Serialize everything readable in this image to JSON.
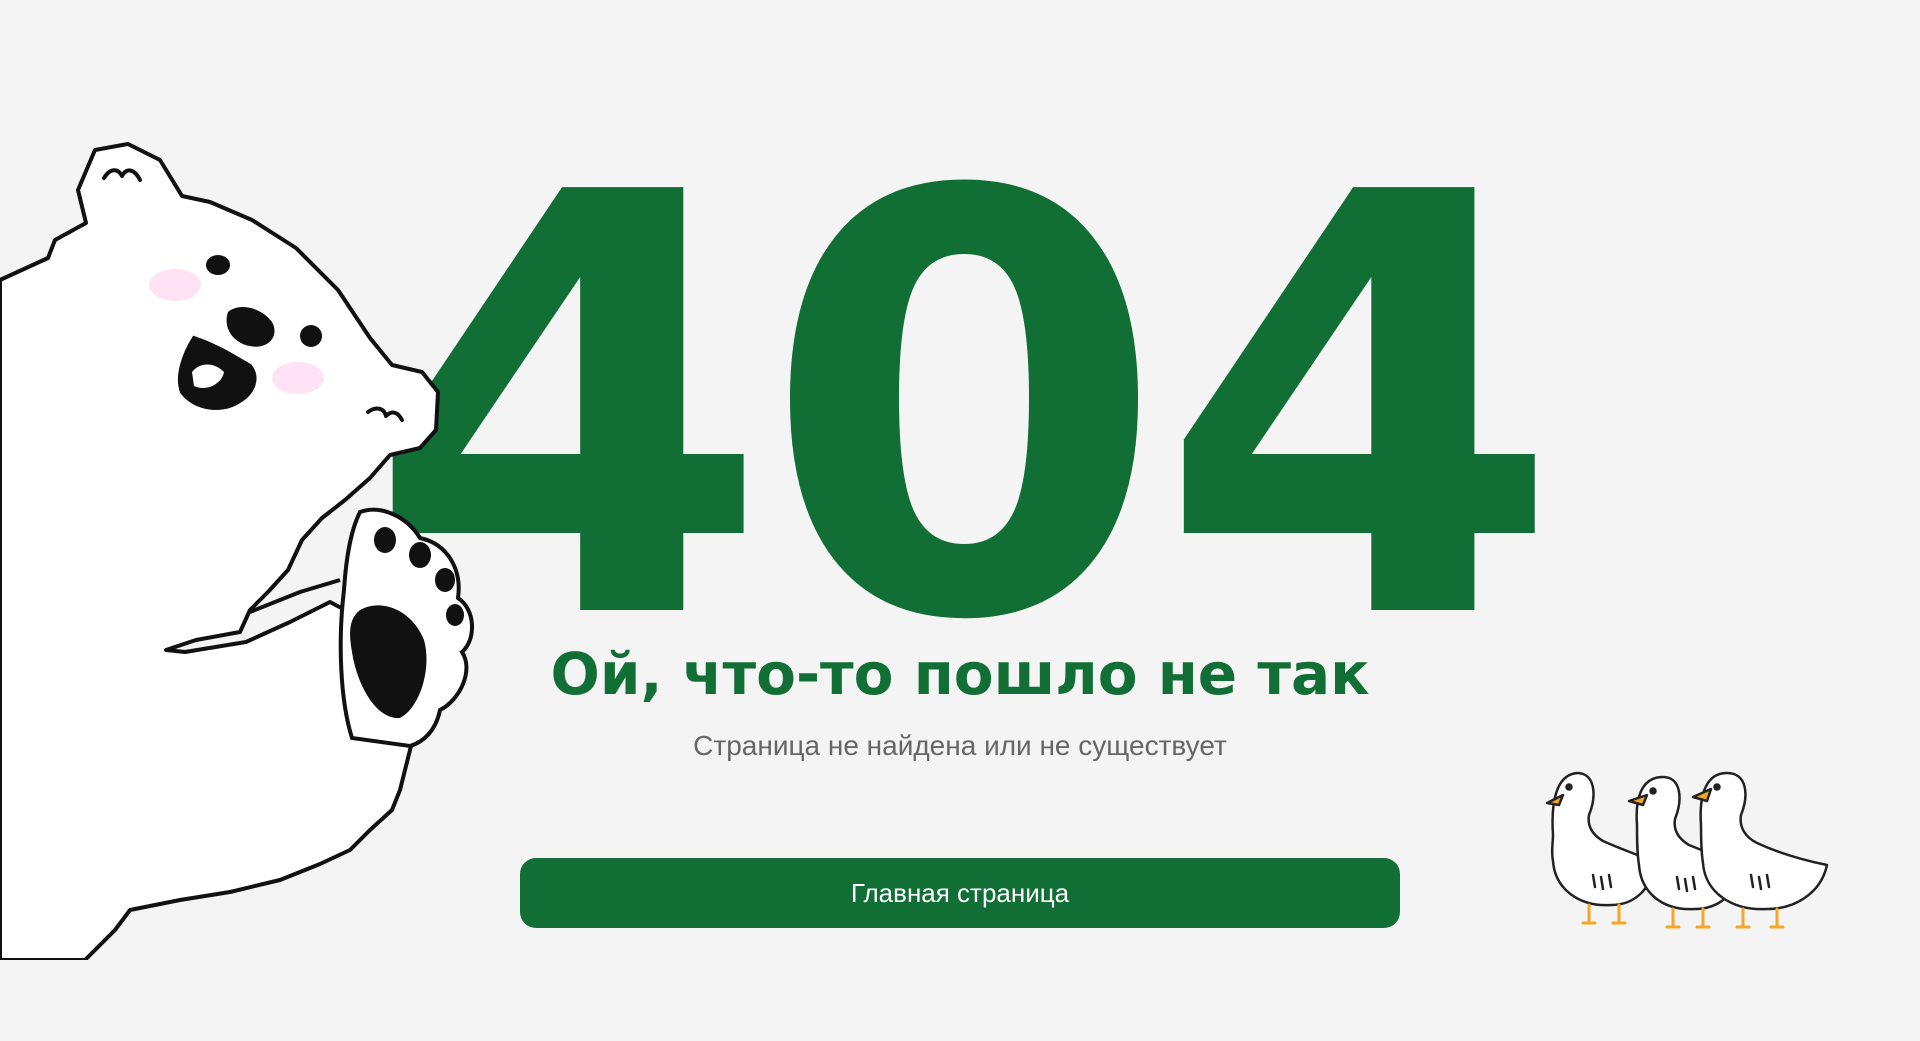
{
  "error": {
    "code": "404",
    "headline": "Ой, что-то пошло не так",
    "message": "Страница не найдена или не существует"
  },
  "actions": {
    "home_label": "Главная страница"
  },
  "colors": {
    "brand_green": "#116f36",
    "background": "#f4f4f4",
    "muted_text": "#666666",
    "goose_beak": "#f5a623"
  },
  "illustrations": {
    "left": "polar-bear-illustration",
    "right": "geese-illustration"
  }
}
